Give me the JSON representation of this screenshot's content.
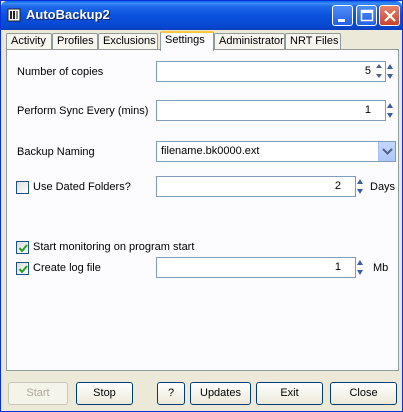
{
  "window": {
    "title": "AutoBackup2"
  },
  "tabs": [
    "Activity",
    "Profiles",
    "Exclusions",
    "Settings",
    "Administrator",
    "NRT Files"
  ],
  "settings": {
    "copies_label": "Number of copies",
    "copies_value": "5",
    "sync_label": "Perform Sync Every (mins)",
    "sync_value": "1",
    "naming_label": "Backup Naming",
    "naming_value": "filename.bk0000.ext",
    "dated_label": "Use Dated Folders?",
    "dated_checked": false,
    "dated_value": "2",
    "dated_unit": "Days",
    "monitor_label": "Start monitoring on program start",
    "monitor_checked": true,
    "log_label": "Create log file",
    "log_checked": true,
    "log_value": "1",
    "log_unit": "Mb"
  },
  "buttons": {
    "start": "Start",
    "stop": "Stop",
    "help": "?",
    "updates": "Updates",
    "exit": "Exit",
    "close": "Close"
  }
}
